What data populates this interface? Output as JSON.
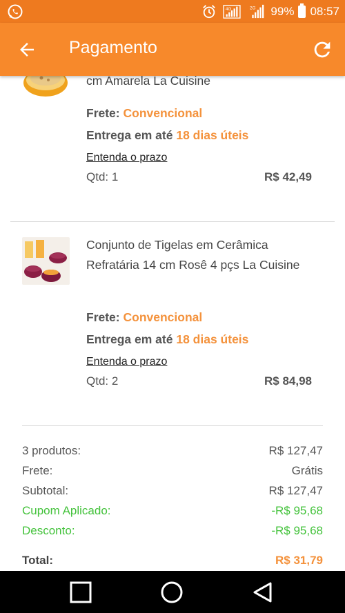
{
  "status_bar": {
    "battery": "99%",
    "time": "08:57",
    "left_icon": "whatsapp-icon",
    "network_labels": [
      "4G",
      "2G"
    ]
  },
  "app_bar": {
    "title": "Pagamento",
    "back_icon": "arrow-back-icon",
    "refresh_icon": "refresh-icon"
  },
  "items": [
    {
      "name": "cm Amarela La Cuisine",
      "frete_label": "Frete:",
      "frete_value": "Convencional",
      "entrega_label": "Entrega em até",
      "entrega_value": "18 dias úteis",
      "prazo_link": "Entenda o prazo",
      "qtd": "Qtd: 1",
      "price": "R$ 42,49"
    },
    {
      "name": "Conjunto de Tigelas em Cerâmica Refratária 14 cm Rosê 4 pçs La Cuisine",
      "frete_label": "Frete:",
      "frete_value": "Convencional",
      "entrega_label": "Entrega em até",
      "entrega_value": "18 dias úteis",
      "prazo_link": "Entenda o prazo",
      "qtd": "Qtd: 2",
      "price": "R$ 84,98"
    }
  ],
  "summary": {
    "produtos_label": "3 produtos:",
    "produtos_value": "R$ 127,47",
    "frete_label": "Frete:",
    "frete_value": "Grátis",
    "subtotal_label": "Subtotal:",
    "subtotal_value": "R$ 127,47",
    "cupom_label": "Cupom Aplicado:",
    "cupom_value": "-R$ 95,68",
    "desconto_label": "Desconto:",
    "desconto_value": "-R$ 95,68",
    "total_label": "Total:",
    "total_value": "R$ 31,79"
  },
  "colors": {
    "status_bar": "#ee7a1f",
    "app_bar": "#f7892b",
    "accent": "#f4923c",
    "discount_green": "#43c23b"
  },
  "nav_bar": {
    "recents_icon": "square-icon",
    "home_icon": "circle-icon",
    "back_icon": "triangle-back-icon"
  }
}
